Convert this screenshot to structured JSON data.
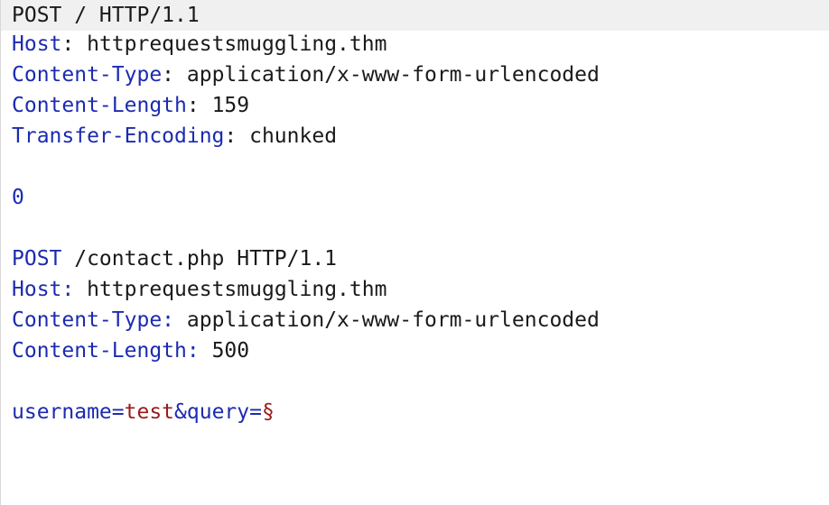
{
  "request_lines": [
    {
      "method": "POST",
      "rest": " / HTTP/1.1"
    },
    {
      "name": "Host",
      "sep": ": ",
      "value": "httprequestsmuggling.thm"
    },
    {
      "name": "Content-Type",
      "sep": ": ",
      "value": "application/x-www-form-urlencoded"
    },
    {
      "name": "Content-Length",
      "sep": ": ",
      "value": "159"
    },
    {
      "name": "Transfer-Encoding",
      "sep": ": ",
      "value": "chunked"
    },
    {
      "chunk": "0"
    },
    {
      "method": "POST",
      "rest": " /contact.php HTTP/1.1"
    },
    {
      "name": "Host:",
      "sep": " ",
      "value": "httprequestsmuggling.thm"
    },
    {
      "name": "Content-Type:",
      "sep": " ",
      "value": "application/x-www-form-urlencoded"
    },
    {
      "name": "Content-Length:",
      "sep": " ",
      "value": "500"
    }
  ],
  "body": {
    "param1_name": "username",
    "eq": "=",
    "param1_value": "test",
    "amp": "&",
    "param2_name": "query",
    "eq2": "=",
    "payload_marker": "§"
  }
}
